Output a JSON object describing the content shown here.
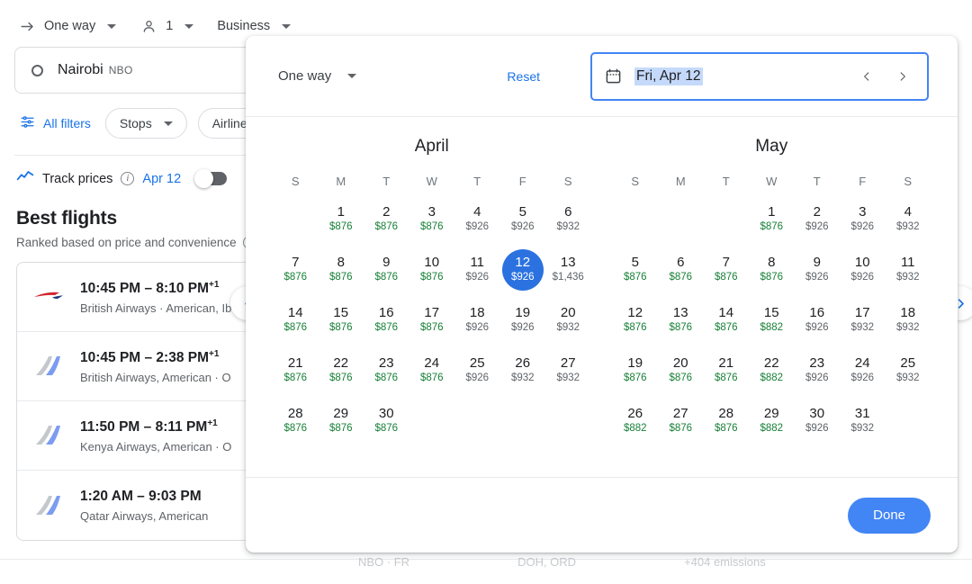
{
  "background": {
    "trip_controls": [
      {
        "icon": "arrow-right-icon",
        "label": "One way",
        "has_caret": true
      },
      {
        "icon": "person-icon",
        "label": "1",
        "has_caret": true
      },
      {
        "icon": "",
        "label": "Business",
        "has_caret": true
      }
    ],
    "origin": {
      "icon": "circle-icon",
      "city": "Nairobi",
      "code": "NBO"
    },
    "filters": {
      "all_filters": "All filters",
      "chips": [
        "Stops",
        "Airlines"
      ]
    },
    "track_prices": {
      "label": "Track prices",
      "info_icon": "info-icon",
      "date": "Apr 12",
      "toggle_state": "off"
    },
    "best_flights": {
      "title": "Best flights",
      "subtitle": "Ranked based on price and convenience",
      "info_icon": "info-icon",
      "rows": [
        {
          "logo": "british-airways-logo",
          "times": "10:45 PM – 8:10 PM",
          "plus": "+1",
          "airlines": "British Airways · American, Ib"
        },
        {
          "logo": "generic-tail-logo",
          "times": "10:45 PM – 2:38 PM",
          "plus": "+1",
          "airlines": "British Airways, American · O"
        },
        {
          "logo": "generic-tail-logo",
          "times": "11:50 PM – 8:11 PM",
          "plus": "+1",
          "airlines": "Kenya Airways, American · O"
        },
        {
          "logo": "generic-tail-logo",
          "times": "1:20 AM – 9:03 PM",
          "plus": "",
          "airlines": "Qatar Airways, American"
        }
      ]
    },
    "obscured_bottom": [
      "NBO · FR",
      "DOH, ORD",
      "+404 emissions"
    ]
  },
  "carousel": {
    "prev_icon": "chevron-left-icon",
    "next_icon": "chevron-right-icon"
  },
  "dialog": {
    "trip_type": "One way",
    "trip_caret_icon": "caret-down-icon",
    "reset_label": "Reset",
    "date_field": {
      "calendar_icon": "calendar-icon",
      "value": "Fri, Apr 12",
      "prev_icon": "chevron-left-icon",
      "next_icon": "chevron-right-icon"
    },
    "done_label": "Done",
    "dow": [
      "S",
      "M",
      "T",
      "W",
      "T",
      "F",
      "S"
    ],
    "months": [
      {
        "name": "April",
        "lead_blanks": 1,
        "days": [
          {
            "d": "1",
            "p": "$876",
            "tier": "low"
          },
          {
            "d": "2",
            "p": "$876",
            "tier": "low"
          },
          {
            "d": "3",
            "p": "$876",
            "tier": "low"
          },
          {
            "d": "4",
            "p": "$926",
            "tier": "mid"
          },
          {
            "d": "5",
            "p": "$926",
            "tier": "mid"
          },
          {
            "d": "6",
            "p": "$932",
            "tier": "mid"
          },
          {
            "d": "7",
            "p": "$876",
            "tier": "low"
          },
          {
            "d": "8",
            "p": "$876",
            "tier": "low"
          },
          {
            "d": "9",
            "p": "$876",
            "tier": "low"
          },
          {
            "d": "10",
            "p": "$876",
            "tier": "low"
          },
          {
            "d": "11",
            "p": "$926",
            "tier": "mid"
          },
          {
            "d": "12",
            "p": "$926",
            "tier": "mid",
            "selected": true
          },
          {
            "d": "13",
            "p": "$1,436",
            "tier": "mid"
          },
          {
            "d": "14",
            "p": "$876",
            "tier": "low"
          },
          {
            "d": "15",
            "p": "$876",
            "tier": "low"
          },
          {
            "d": "16",
            "p": "$876",
            "tier": "low"
          },
          {
            "d": "17",
            "p": "$876",
            "tier": "low"
          },
          {
            "d": "18",
            "p": "$926",
            "tier": "mid"
          },
          {
            "d": "19",
            "p": "$926",
            "tier": "mid"
          },
          {
            "d": "20",
            "p": "$932",
            "tier": "mid"
          },
          {
            "d": "21",
            "p": "$876",
            "tier": "low"
          },
          {
            "d": "22",
            "p": "$876",
            "tier": "low"
          },
          {
            "d": "23",
            "p": "$876",
            "tier": "low"
          },
          {
            "d": "24",
            "p": "$876",
            "tier": "low"
          },
          {
            "d": "25",
            "p": "$926",
            "tier": "mid"
          },
          {
            "d": "26",
            "p": "$932",
            "tier": "mid"
          },
          {
            "d": "27",
            "p": "$932",
            "tier": "mid"
          },
          {
            "d": "28",
            "p": "$876",
            "tier": "low"
          },
          {
            "d": "29",
            "p": "$876",
            "tier": "low"
          },
          {
            "d": "30",
            "p": "$876",
            "tier": "low"
          }
        ]
      },
      {
        "name": "May",
        "lead_blanks": 3,
        "days": [
          {
            "d": "1",
            "p": "$876",
            "tier": "low"
          },
          {
            "d": "2",
            "p": "$926",
            "tier": "mid"
          },
          {
            "d": "3",
            "p": "$926",
            "tier": "mid"
          },
          {
            "d": "4",
            "p": "$932",
            "tier": "mid"
          },
          {
            "d": "5",
            "p": "$876",
            "tier": "low"
          },
          {
            "d": "6",
            "p": "$876",
            "tier": "low"
          },
          {
            "d": "7",
            "p": "$876",
            "tier": "low"
          },
          {
            "d": "8",
            "p": "$876",
            "tier": "low"
          },
          {
            "d": "9",
            "p": "$926",
            "tier": "mid"
          },
          {
            "d": "10",
            "p": "$926",
            "tier": "mid"
          },
          {
            "d": "11",
            "p": "$932",
            "tier": "mid"
          },
          {
            "d": "12",
            "p": "$876",
            "tier": "low"
          },
          {
            "d": "13",
            "p": "$876",
            "tier": "low"
          },
          {
            "d": "14",
            "p": "$876",
            "tier": "low"
          },
          {
            "d": "15",
            "p": "$882",
            "tier": "low"
          },
          {
            "d": "16",
            "p": "$926",
            "tier": "mid"
          },
          {
            "d": "17",
            "p": "$932",
            "tier": "mid"
          },
          {
            "d": "18",
            "p": "$932",
            "tier": "mid"
          },
          {
            "d": "19",
            "p": "$876",
            "tier": "low"
          },
          {
            "d": "20",
            "p": "$876",
            "tier": "low"
          },
          {
            "d": "21",
            "p": "$876",
            "tier": "low"
          },
          {
            "d": "22",
            "p": "$882",
            "tier": "low"
          },
          {
            "d": "23",
            "p": "$926",
            "tier": "mid"
          },
          {
            "d": "24",
            "p": "$926",
            "tier": "mid"
          },
          {
            "d": "25",
            "p": "$932",
            "tier": "mid"
          },
          {
            "d": "26",
            "p": "$882",
            "tier": "low"
          },
          {
            "d": "27",
            "p": "$876",
            "tier": "low"
          },
          {
            "d": "28",
            "p": "$876",
            "tier": "low"
          },
          {
            "d": "29",
            "p": "$882",
            "tier": "low"
          },
          {
            "d": "30",
            "p": "$926",
            "tier": "mid"
          },
          {
            "d": "31",
            "p": "$932",
            "tier": "mid"
          }
        ]
      }
    ]
  },
  "colors": {
    "accent_blue": "#1a73e8",
    "selected_blue": "#2b72e0",
    "done_blue": "#4285f4",
    "price_low_green": "#188038",
    "price_mid_gray": "#5f6368",
    "selection_highlight": "#c5dafb"
  }
}
